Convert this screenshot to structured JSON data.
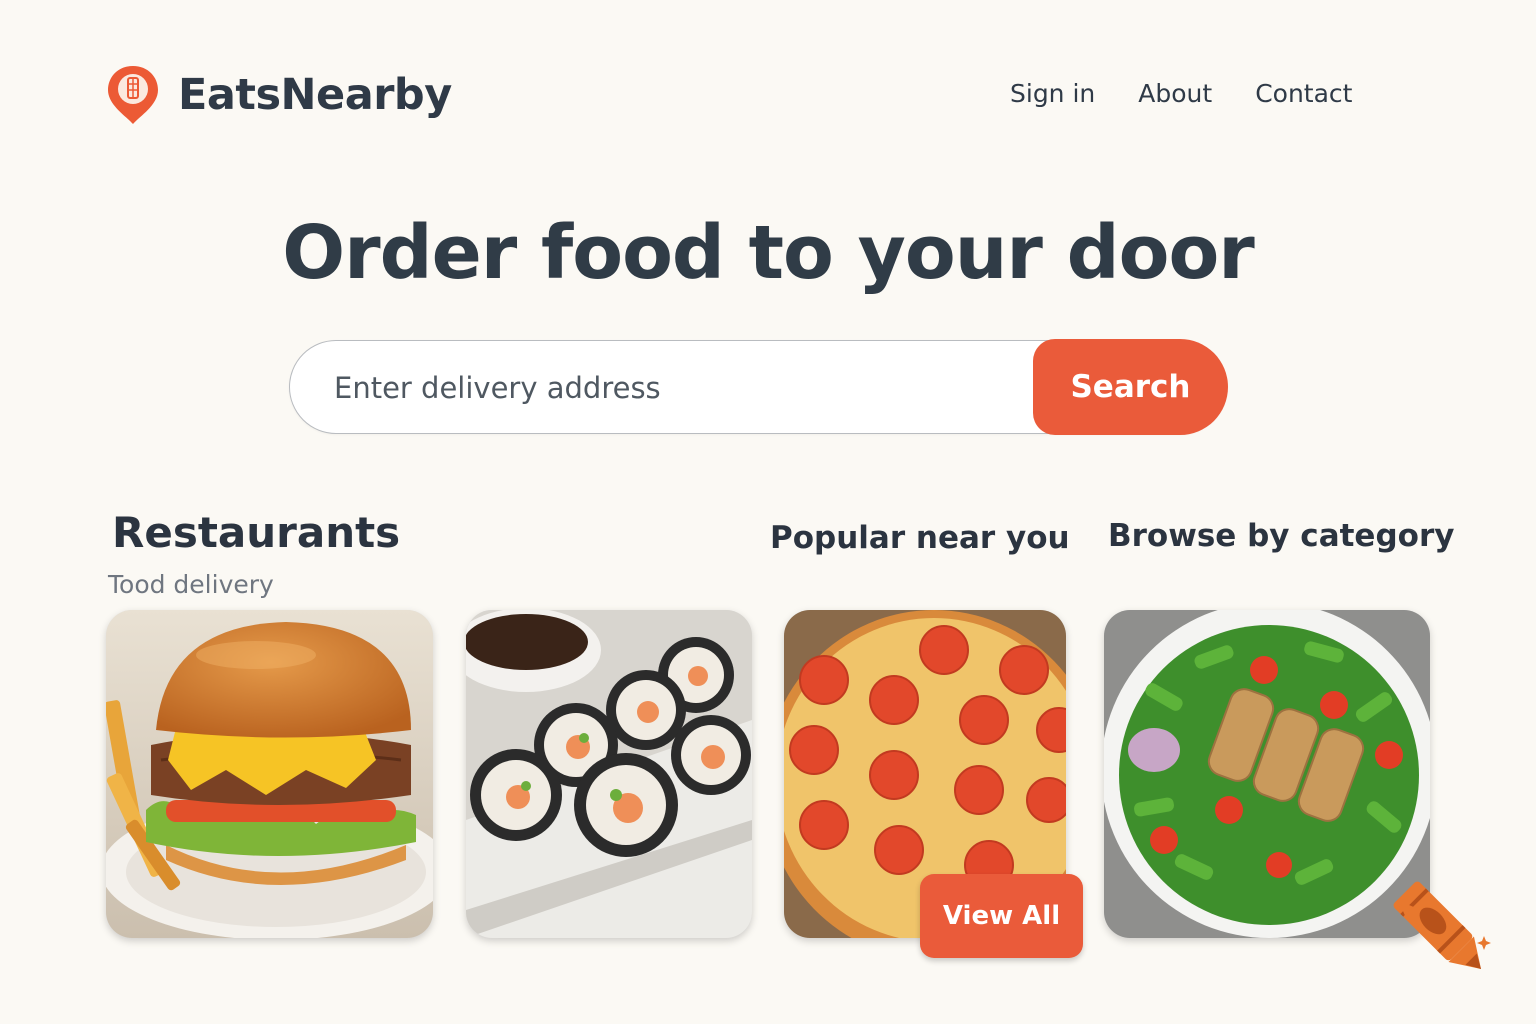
{
  "header": {
    "brand": "EatsNearby",
    "nav": [
      "Sign in",
      "About",
      "Contact"
    ]
  },
  "hero": {
    "title": "Order food to your door",
    "search_placeholder": "Enter delivery address",
    "search_button": "Search"
  },
  "sections": {
    "restaurants_title": "Restaurants",
    "restaurants_subtitle": "Tood delivery",
    "popular_title": "Popular near you",
    "browse_title": "Browse by category",
    "view_all_button": "View All"
  },
  "cards": [
    {
      "food": "burger",
      "icon": "burger-photo"
    },
    {
      "food": "sushi",
      "icon": "sushi-photo"
    },
    {
      "food": "pizza",
      "icon": "pizza-photo"
    },
    {
      "food": "salad",
      "icon": "salad-photo"
    }
  ],
  "colors": {
    "background": "#fbf9f4",
    "accent": "#ea5b3a",
    "text": "#2b3440",
    "muted": "#6f7680"
  },
  "icons": {
    "logo": "location-pin-icon",
    "decoration": "crayon-icon"
  }
}
